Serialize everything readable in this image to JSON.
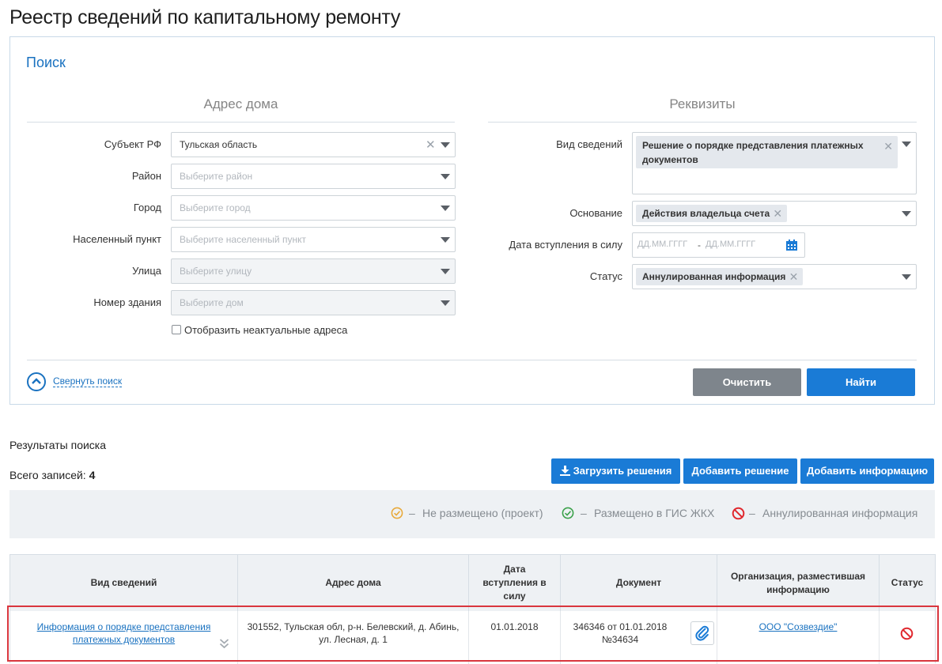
{
  "page_title": "Реестр сведений по капитальному ремонту",
  "search": {
    "title": "Поиск",
    "address_section": "Адрес дома",
    "requisites_section": "Реквизиты",
    "fields": {
      "subject": {
        "label": "Субъект РФ",
        "value": "Тульская область"
      },
      "district": {
        "label": "Район",
        "placeholder": "Выберите район"
      },
      "city": {
        "label": "Город",
        "placeholder": "Выберите город"
      },
      "settlement": {
        "label": "Населенный пункт",
        "placeholder": "Выберите населенный пункт"
      },
      "street": {
        "label": "Улица",
        "placeholder": "Выберите улицу"
      },
      "building": {
        "label": "Номер здания",
        "placeholder": "Выберите дом"
      },
      "show_outdated": {
        "label": "Отобразить неактуальные адреса",
        "checked": false
      },
      "info_type": {
        "label": "Вид сведений",
        "tag": "Решение о порядке представления платежных документов"
      },
      "basis": {
        "label": "Основание",
        "tag": "Действия владельца счета"
      },
      "effective_date": {
        "label": "Дата вступления в силу",
        "from_placeholder": "ДД.ММ.ГГГГ",
        "separator": "-",
        "to_placeholder": "ДД.ММ.ГГГГ"
      },
      "status": {
        "label": "Статус",
        "tag": "Аннулированная информация"
      }
    },
    "collapse_label": "Свернуть поиск",
    "clear_label": "Очистить",
    "find_label": "Найти"
  },
  "results": {
    "title": "Результаты поиска",
    "total_label": "Всего записей:",
    "total_value": "4",
    "upload_label": "Загрузить решения",
    "add_decision_label": "Добавить решение",
    "add_info_label": "Добавить информацию",
    "legend": [
      {
        "icon": "check-circle-orange-icon",
        "text": "Не размещено (проект)",
        "color": "#e8a93a"
      },
      {
        "icon": "check-circle-green-icon",
        "text": "Размещено в ГИС ЖКХ",
        "color": "#3aa14a"
      },
      {
        "icon": "cancel-circle-red-icon",
        "text": "Аннулированная информация",
        "color": "#e0282e"
      }
    ],
    "legend_dash": "–",
    "columns": [
      "Вид сведений",
      "Адрес дома",
      "Дата вступления в силу",
      "Документ",
      "Организация, разместившая информацию",
      "Статус"
    ],
    "rows": [
      {
        "info_type": "Информация о порядке представления платежных документов",
        "address": "301552, Тульская обл, р-н. Белевский, д. Абинь, ул. Лесная, д. 1",
        "date": "01.01.2018",
        "document": "346346 от 01.01.2018 №34634",
        "organization": "ООО \"Созвездие\"",
        "status_icon": "cancel-circle-red-icon"
      }
    ]
  },
  "colors": {
    "accent": "#1a7bd6",
    "danger": "#d9363e"
  }
}
